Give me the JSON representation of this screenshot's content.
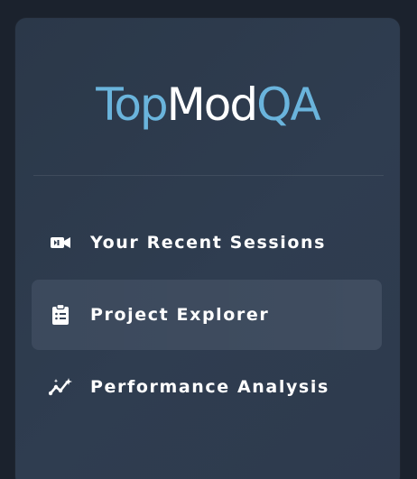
{
  "brand": {
    "part1": "Top",
    "part2": "Mod",
    "part3": "QA"
  },
  "nav": {
    "items": [
      {
        "label": "Your Recent Sessions",
        "icon": "video-camera-icon",
        "active": false
      },
      {
        "label": "Project Explorer",
        "icon": "clipboard-list-icon",
        "active": true
      },
      {
        "label": "Performance Analysis",
        "icon": "chart-line-icon",
        "active": false
      }
    ]
  },
  "colors": {
    "accent": "#6ab4dc",
    "sidebar_bg": "#2e3b4e",
    "active_item_bg": "#344256",
    "text": "#ffffff"
  }
}
